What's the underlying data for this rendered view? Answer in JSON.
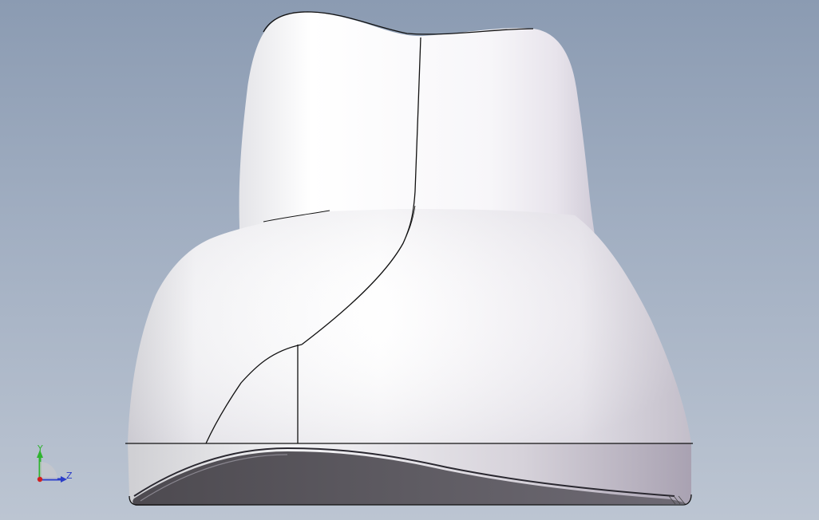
{
  "viewport": {
    "background_top": "#8b9bb2",
    "background_bottom": "#bcc5d2"
  },
  "model": {
    "body_color": "#ffffff",
    "edge_color": "#111111",
    "underside_color": "#5a575d"
  },
  "triad": {
    "y_label": "Y",
    "z_label": "Z",
    "y_axis_color": "#2fb32f",
    "z_axis_color": "#2a3cc8",
    "origin_color": "#d02020"
  }
}
